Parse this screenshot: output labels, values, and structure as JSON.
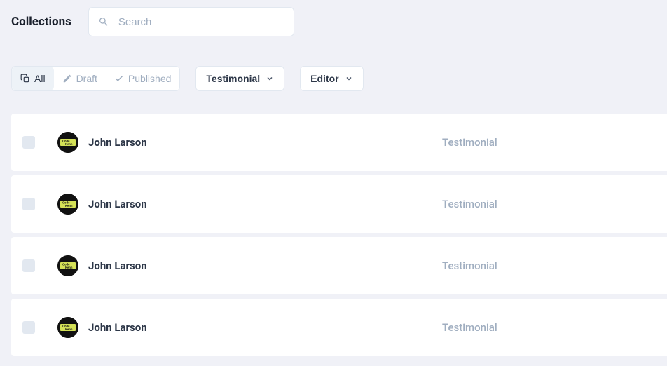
{
  "header": {
    "title": "Collections",
    "search_placeholder": "Search"
  },
  "filters": {
    "status": {
      "all": "All",
      "draft": "Draft",
      "published": "Published"
    },
    "type_dropdown": "Testimonial",
    "editor_dropdown": "Editor"
  },
  "rows": [
    {
      "name": "John Larson",
      "category": "Testimonial"
    },
    {
      "name": "John Larson",
      "category": "Testimonial"
    },
    {
      "name": "John Larson",
      "category": "Testimonial"
    },
    {
      "name": "John Larson",
      "category": "Testimonial"
    }
  ]
}
